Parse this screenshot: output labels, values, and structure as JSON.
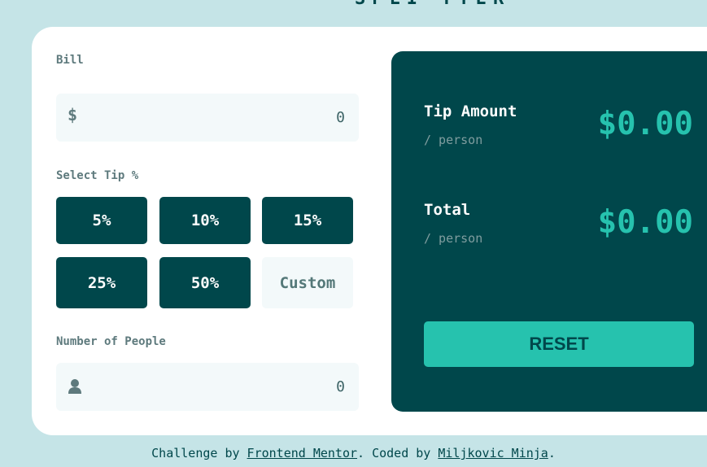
{
  "logo": {
    "text": "SPLI TTER"
  },
  "bill": {
    "label": "Bill",
    "currency_symbol": "$",
    "value": "0"
  },
  "tip": {
    "label": "Select Tip %",
    "options": [
      "5%",
      "10%",
      "15%",
      "25%",
      "50%"
    ],
    "custom_placeholder": "Custom"
  },
  "people": {
    "label": "Number of People",
    "value": "0",
    "icon": "person-icon"
  },
  "results": {
    "tip_amount": {
      "title": "Tip Amount",
      "sub": "/ person",
      "value": "$0.00"
    },
    "total": {
      "title": "Total",
      "sub": "/ person",
      "value": "$0.00"
    },
    "reset_label": "RESET"
  },
  "footer": {
    "prefix": "Challenge by ",
    "link1": "Frontend Mentor",
    "middle": ". Coded by ",
    "link2": "Miljkovic Minja",
    "suffix": "."
  },
  "colors": {
    "background": "#c5e4e7",
    "dark_cyan": "#00474b",
    "strong_cyan": "#26c2ae",
    "input_bg": "#f3f9fa"
  }
}
